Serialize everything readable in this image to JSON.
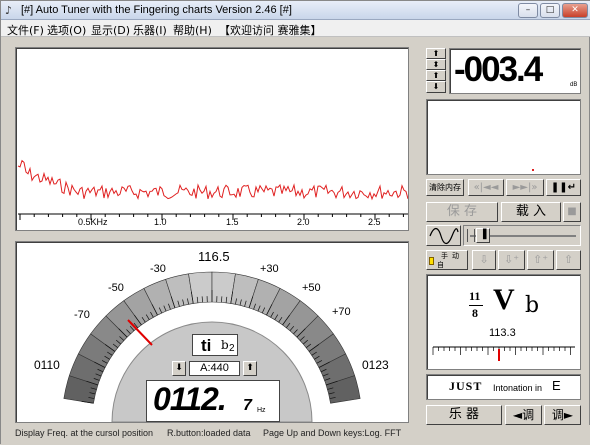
{
  "title": "[#] Auto Tuner with the Fingering charts  Version 2.46 [#]",
  "menu": [
    "文件(F)",
    "选项(O)",
    "显示(D)",
    "乐器(I)",
    "帮助(H)",
    "【欢迎访问 赛雅集】"
  ],
  "spectrum": {
    "x_ticks": [
      "0.5KHz",
      "1.0",
      "1.5",
      "2.0",
      "2.5"
    ],
    "line_color": "#e02020"
  },
  "meter": {
    "center_value": "116.5",
    "left_value": "0110",
    "right_value": "0123",
    "scale_labels": [
      "-70",
      "-50",
      "-30",
      "+30",
      "+50",
      "+70"
    ],
    "note_name": "ti",
    "note_accidental": "b",
    "note_subscript": "2",
    "a_ref": "A:440",
    "freq_main": "0112.",
    "freq_decimal": "7",
    "freq_unit": "Hz"
  },
  "db_display": {
    "value": "-003.4",
    "unit": "dB"
  },
  "buttons": {
    "clear_memory": "清除内存",
    "save": "保 存",
    "load": "载 入",
    "hand": "手",
    "auto": "自",
    "move": "动",
    "instrument": "乐 器",
    "tune_left": "◄调",
    "tune_right": "调►"
  },
  "notation": {
    "fraction_top": "11",
    "fraction_bottom": "8",
    "letter": "V",
    "accidental": "b",
    "value": "113.3"
  },
  "intonation": {
    "just": "JUST",
    "text": "Intonation in",
    "key": "E"
  },
  "status": {
    "left": "Display Freq. at the cursol position",
    "middle": "R.button:loaded data",
    "right": "Page Up and Down keys:Log. FFT"
  }
}
